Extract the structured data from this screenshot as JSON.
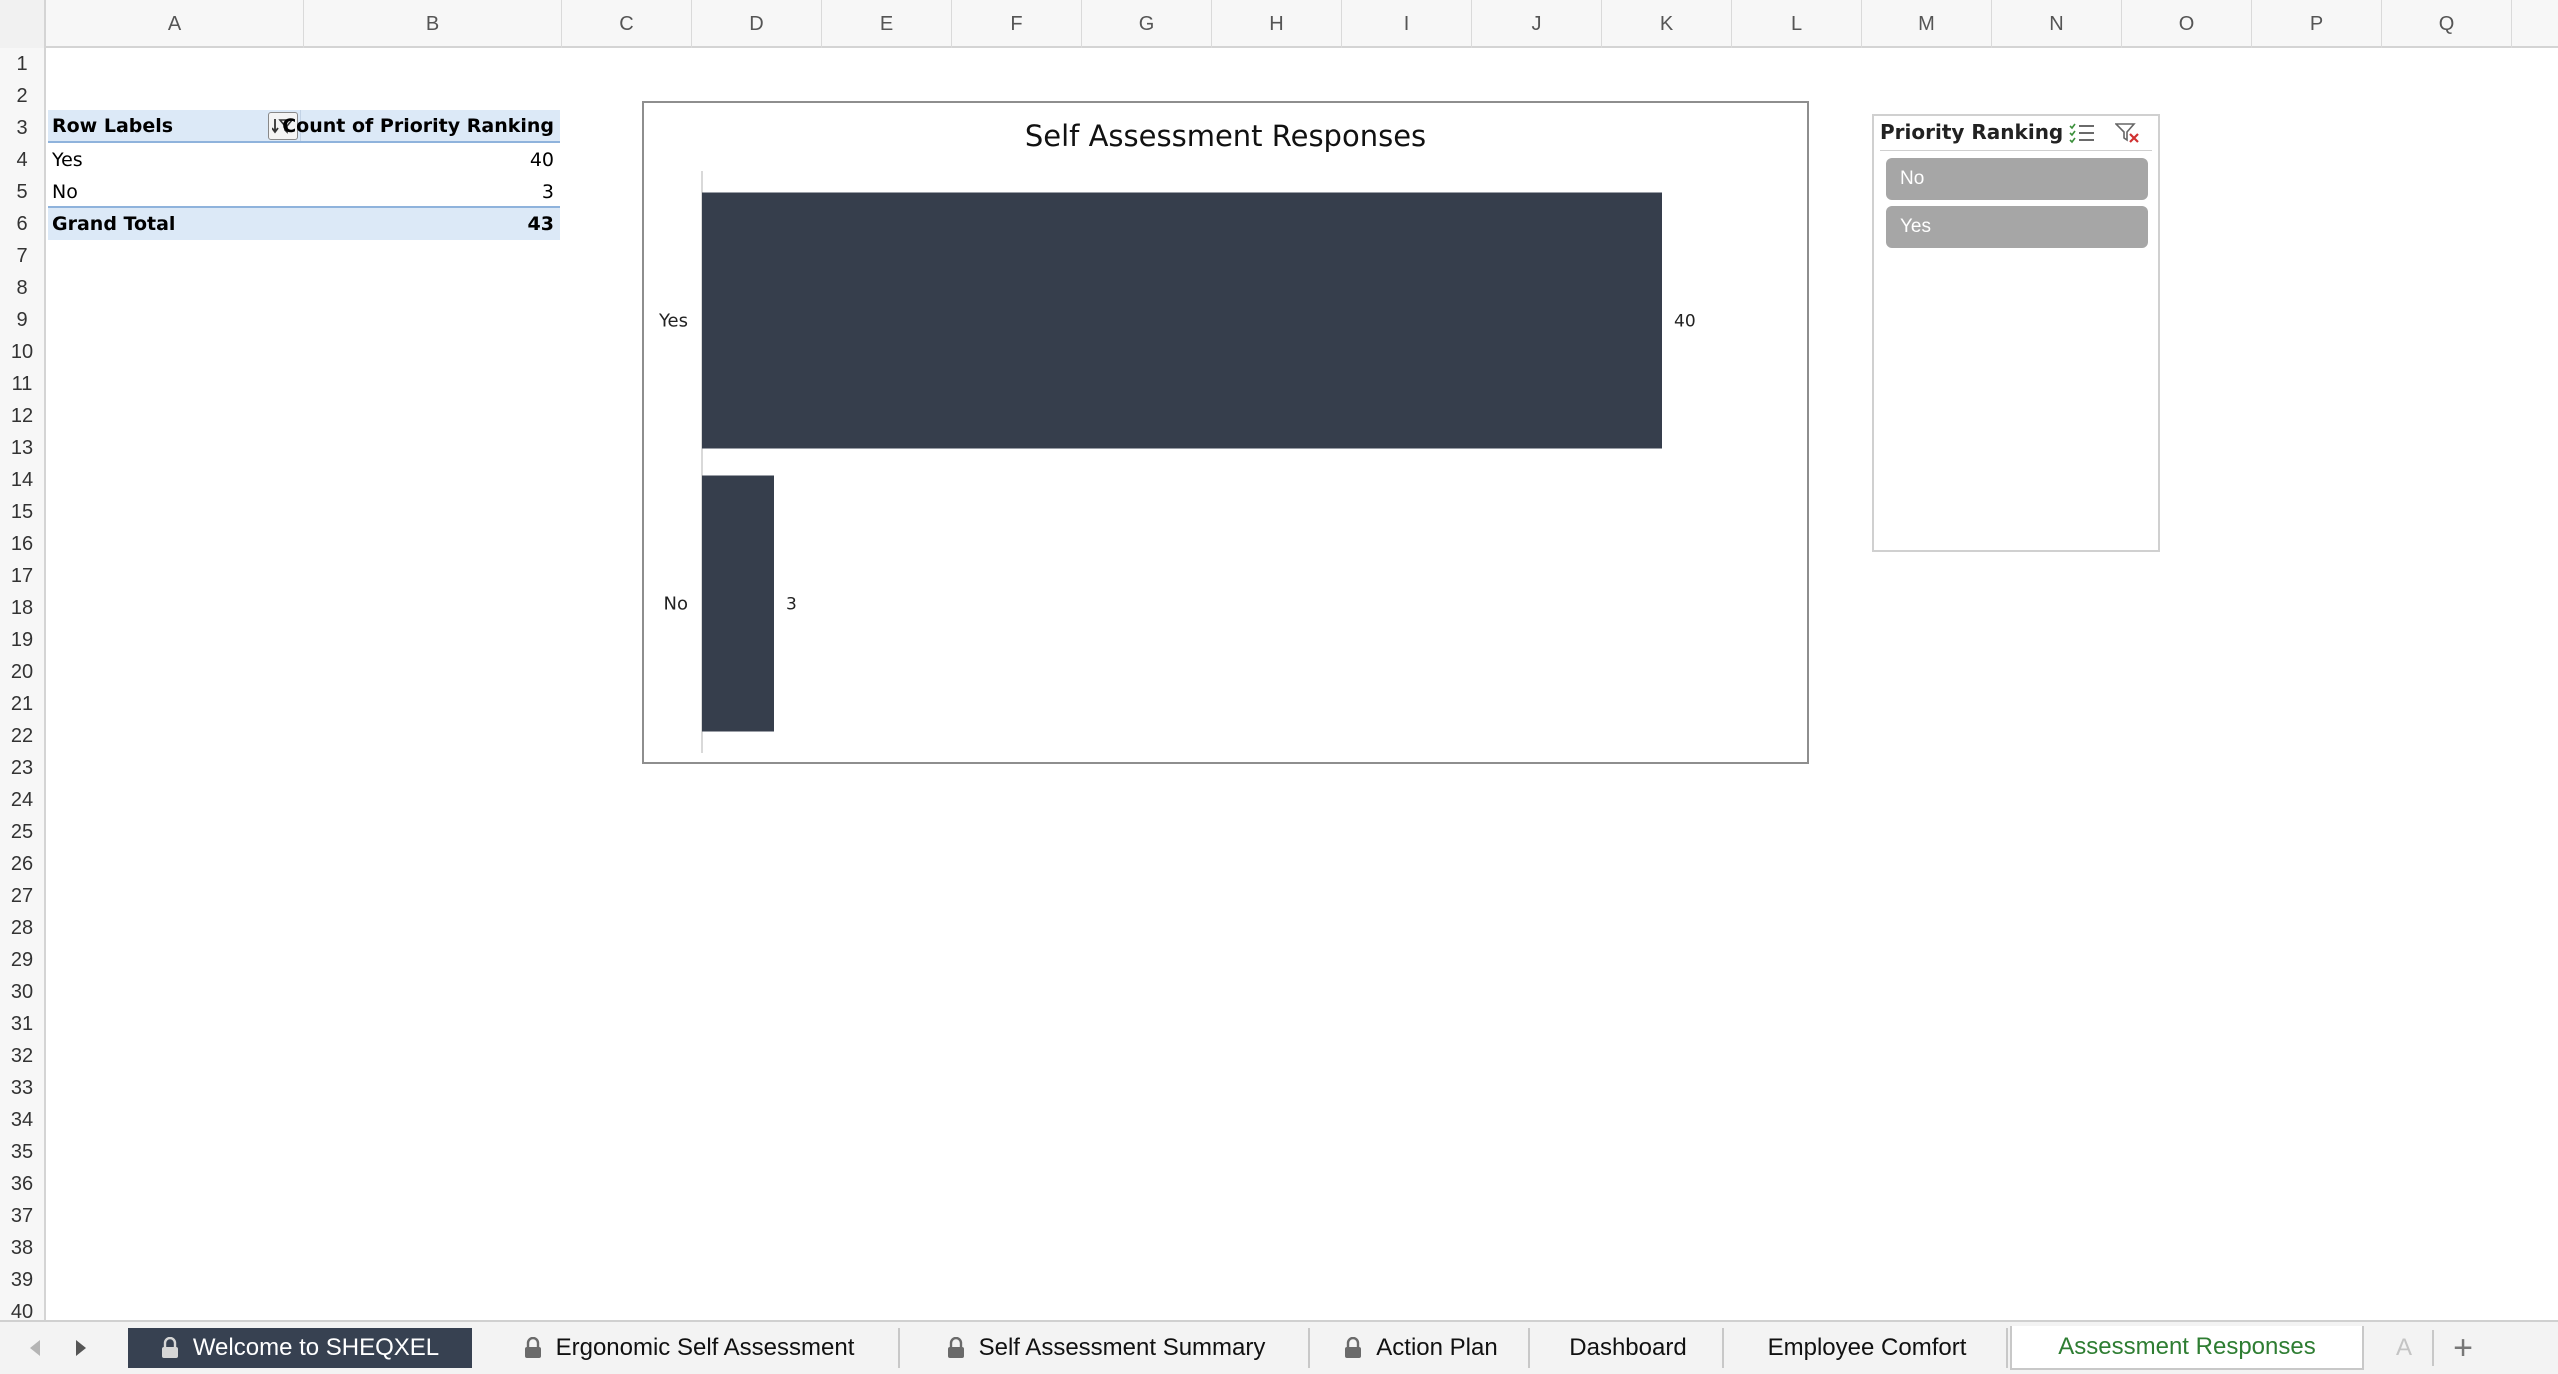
{
  "columns": [
    "A",
    "B",
    "C",
    "D",
    "E",
    "F",
    "G",
    "H",
    "I",
    "J",
    "K",
    "L",
    "M",
    "N",
    "O",
    "P",
    "Q"
  ],
  "row_count": 40,
  "pivot": {
    "header_row_label": "Row Labels",
    "header_value_label": "Count of Priority Ranking",
    "rows": [
      {
        "label": "Yes",
        "value": "40"
      },
      {
        "label": "No",
        "value": "3"
      }
    ],
    "total_label": "Grand Total",
    "total_value": "43"
  },
  "chart_data": {
    "type": "bar",
    "orientation": "horizontal",
    "title": "Self Assessment Responses",
    "categories": [
      "Yes",
      "No"
    ],
    "values": [
      40,
      3
    ],
    "data_labels": [
      "40",
      "3"
    ],
    "xlabel": "",
    "ylabel": "",
    "xlim": [
      0,
      45
    ],
    "grid": false,
    "legend": "none",
    "bar_color": "#363e4c"
  },
  "slicer": {
    "title": "Priority Ranking",
    "items": [
      "No",
      "Yes"
    ],
    "multi_select_icon": "multi-select-icon",
    "clear_filter_icon": "clear-filter-icon"
  },
  "sheet_tabs": [
    {
      "label": "Welcome to SHEQXEL",
      "locked": true,
      "style": "dark"
    },
    {
      "label": "Ergonomic Self Assessment",
      "locked": true,
      "style": "normal"
    },
    {
      "label": "Self Assessment Summary",
      "locked": true,
      "style": "normal"
    },
    {
      "label": "Action Plan",
      "locked": true,
      "style": "normal"
    },
    {
      "label": "Dashboard",
      "locked": false,
      "style": "normal"
    },
    {
      "label": "Employee Comfort",
      "locked": false,
      "style": "normal"
    },
    {
      "label": "Assessment Responses",
      "locked": false,
      "style": "active"
    }
  ],
  "tab_overflow": "A",
  "add_sheet_label": "+",
  "colors": {
    "active_tab_text": "#2e7d32",
    "dark_tab_bg": "#374151",
    "pivot_header_bg": "#dce9f7",
    "slicer_item_bg": "#a6a6a6"
  }
}
